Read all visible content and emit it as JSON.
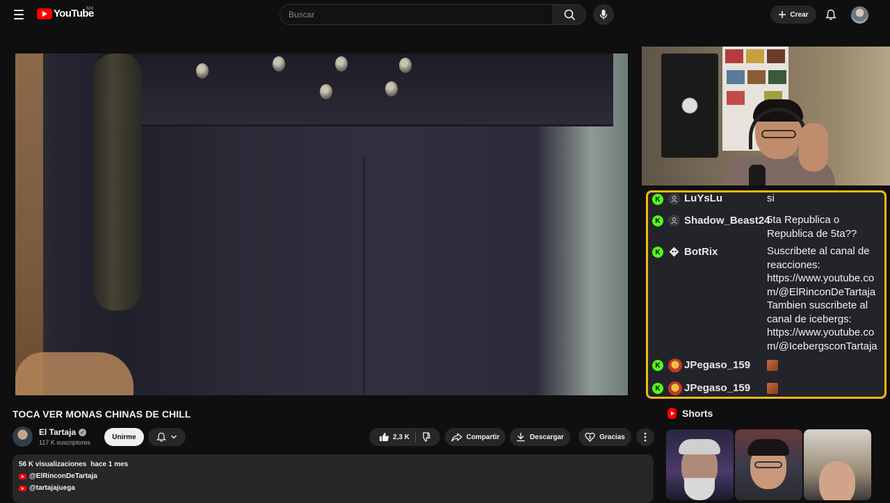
{
  "header": {
    "logo_text": "YouTube",
    "country": "MX",
    "search_placeholder": "Buscar",
    "create_label": "Crear"
  },
  "video": {
    "title": "TOCA VER MONAS CHINAS DE CHILL"
  },
  "channel": {
    "name": "El Tartaja",
    "subscribers": "117 K suscriptores",
    "join_label": "Unirme"
  },
  "actions": {
    "likes": "2,3 K",
    "share_label": "Compartir",
    "download_label": "Descargar",
    "thanks_label": "Gracias"
  },
  "description": {
    "views": "56 K visualizaciones",
    "date": "hace 1 mes",
    "links": [
      "@ElRinconDeTartaja",
      "@tartajajuega"
    ]
  },
  "chat": {
    "badge_letter": "K",
    "messages": [
      {
        "user": "LuYsLu",
        "text": "si"
      },
      {
        "user": "Shadow_Beast24",
        "text": "5ta Republica o\nRepublica de 5ta??"
      },
      {
        "user": "BotRix",
        "text": "Suscribete al canal de\nreacciones:\nhttps://www.youtube.co\nm/@ElRinconDeTartaja\nTambien suscribete al\ncanal de icebergs:\nhttps://www.youtube.co\nm/@IcebergsconTartaja"
      },
      {
        "user": "JPegaso_159",
        "text": ""
      },
      {
        "user": "JPegaso_159",
        "text": ""
      }
    ]
  },
  "shorts": {
    "label": "Shorts"
  },
  "colors": {
    "accent_red": "#ff0000",
    "chat_border": "#f5b915",
    "kick_green": "#53fc18"
  }
}
